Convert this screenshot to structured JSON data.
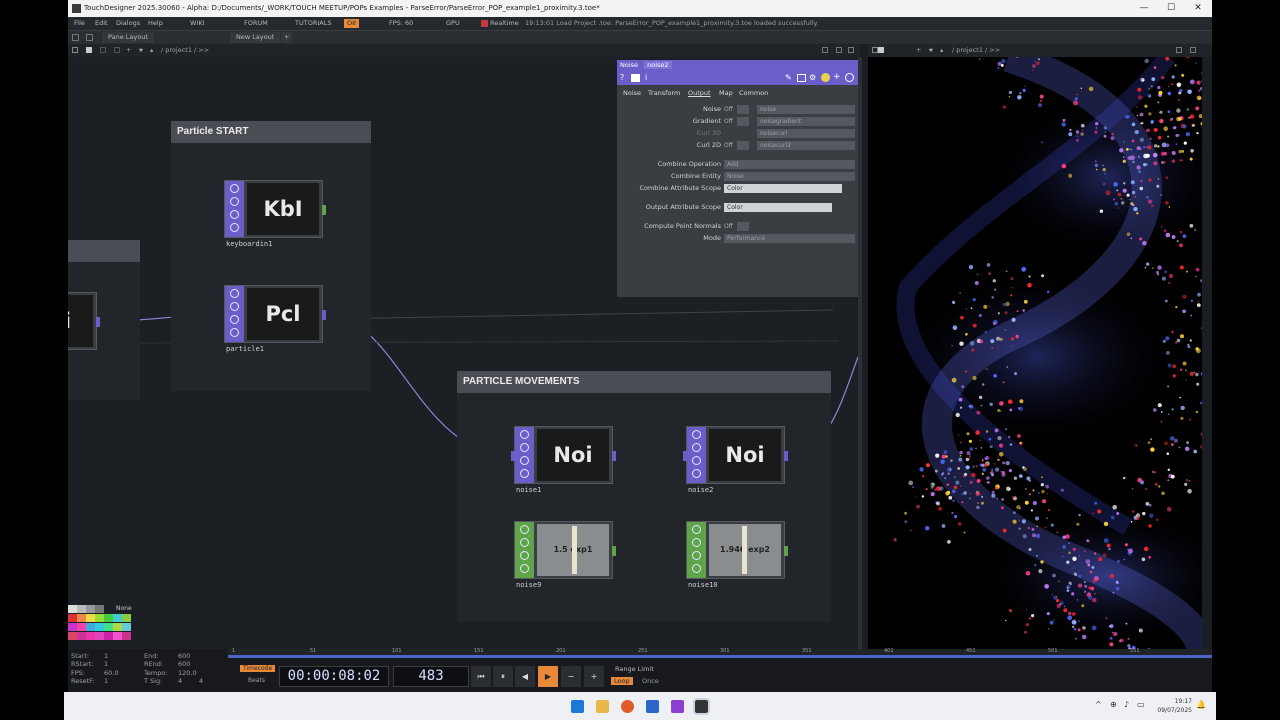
{
  "window": {
    "title": "TouchDesigner 2025.30060 - Alpha: D:/Documents/_WORK/TOUCH MEETUP/POPs Examples - ParseError/ParseError_POP_example1_proximity.3.toe*",
    "controls": [
      "—",
      "☐",
      "✕"
    ]
  },
  "menubar": {
    "items": [
      "File",
      "Edit",
      "Dialogs",
      "Help"
    ],
    "links": [
      "WIKI",
      "FORUM",
      "TUTORIALS"
    ],
    "oi_label": "OII",
    "fps_label": "FPS: 60",
    "gpu_label": "GPU",
    "realtime_label": "Realtime",
    "status": "19:13:01 Load Project .toe: ParseError_POP_example1_proximity.3.toe loaded successfully."
  },
  "toolbar": {
    "pane_layout": "Pane Layout",
    "new_layout": "New Layout",
    "plus": "+"
  },
  "network_path": "/ project1 / >>",
  "viewer_path": "/ project1 / >>",
  "components": {
    "start_title": "Particle START",
    "movements_title": "PARTICLE MOVEMENTS"
  },
  "operators": {
    "keyboard": {
      "tile": "KbI",
      "name": "keyboardin1"
    },
    "particle": {
      "tile": "Pcl",
      "name": "particle1"
    },
    "left_partial": {
      "tile": "i"
    },
    "noise1": {
      "tile": "Noi",
      "name": "noise1"
    },
    "noise2": {
      "tile": "Noi",
      "name": "noise2"
    },
    "noise9": {
      "tile": "1.5 exp1",
      "name": "noise9"
    },
    "noise10": {
      "tile": "1.946 exp2",
      "name": "noise10"
    }
  },
  "params": {
    "type": "Noise",
    "op_name": "noise2",
    "tabs": [
      "Noise",
      "Transform",
      "Output",
      "Map",
      "Common"
    ],
    "rows": [
      {
        "label": "Noise",
        "toggle": "Off",
        "value": "noise"
      },
      {
        "label": "Gradient",
        "toggle": "Off",
        "value": "noisegradient"
      },
      {
        "label": "Curl 3D",
        "toggle": "",
        "value": "noisecurl"
      },
      {
        "label": "Curl 2D",
        "toggle": "Off",
        "value": "noisecurl2"
      },
      {
        "label": "Combine Operation",
        "toggle": "",
        "value": "Add"
      },
      {
        "label": "Combine Entity",
        "toggle": "",
        "value": "Noise"
      },
      {
        "label": "Combine Attribute Scope",
        "toggle": "",
        "value": "Color"
      },
      {
        "label": "Output Attribute Scope",
        "toggle": "",
        "value": "Color"
      },
      {
        "label": "Compute Point Normals",
        "toggle": "Off",
        "value": ""
      },
      {
        "label": "Mode",
        "toggle": "",
        "value": "Performance"
      }
    ]
  },
  "palette": {
    "none_label": "None"
  },
  "timeline": {
    "start_label": "Start:",
    "start": "1",
    "rstart_label": "RStart:",
    "rstart": "1",
    "fps_label": "FPS:",
    "fps": "60.0",
    "resetf_label": "ResetF:",
    "resetf": "1",
    "end_label": "End:",
    "end": "600",
    "rend_label": "REnd:",
    "rend": "600",
    "tempo_label": "Tempo:",
    "tempo": "120.0",
    "tsig_label": "T Sig:",
    "tsig_a": "4",
    "tsig_b": "4",
    "timecode_btn": "Timecode",
    "beats_btn": "Beats",
    "timecode": "00:00:08:02",
    "frame": "483",
    "range_limit": "Range Limit",
    "loop": "Loop",
    "once": "Once",
    "ruler": [
      "1",
      "51",
      "101",
      "151",
      "201",
      "251",
      "301",
      "351",
      "401",
      "451",
      "501",
      "551"
    ]
  },
  "taskbar": {
    "time": "19:17",
    "date": "09/07/2025"
  },
  "colors": {
    "pop_flags": "#6b5ec9",
    "chop_flags": "#5fa44a",
    "wire": "#8b86d6",
    "play_active": "#e8893a"
  }
}
